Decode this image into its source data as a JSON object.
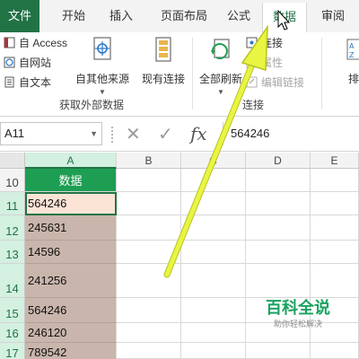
{
  "ribbon_tabs": {
    "file": "文件",
    "home": "开始",
    "insert": "插入",
    "page_layout": "页面布局",
    "formulas": "公式",
    "data": "数据",
    "review": "审阅"
  },
  "ribbon": {
    "from_access": "自 Access",
    "from_web": "自网站",
    "from_text": "自文本",
    "from_other_sources": "自其他来源",
    "existing_connections": "现有连接",
    "refresh_all": "全部刷新",
    "connections": "连接",
    "properties": "属性",
    "edit_links": "编辑链接",
    "group_external_data": "获取外部数据",
    "group_connections": "连接",
    "sort_partial": "排"
  },
  "formula_bar": {
    "name_box": "A11",
    "fx": "fx",
    "value": "564246"
  },
  "columns": [
    "A",
    "B",
    "C",
    "D",
    "E"
  ],
  "rows": [
    {
      "num": "10",
      "value": "数据"
    },
    {
      "num": "11",
      "value": "564246"
    },
    {
      "num": "12",
      "value": "245631"
    },
    {
      "num": "13",
      "value": "14596"
    },
    {
      "num": "14",
      "value": "241256"
    },
    {
      "num": "15",
      "value": "564246"
    },
    {
      "num": "16",
      "value": "246120"
    },
    {
      "num": "17",
      "value": "789542"
    }
  ],
  "watermark": {
    "title": "百科全说",
    "subtitle": "助你轻松解决"
  },
  "colors": {
    "excel_green": "#217346",
    "header_cell": "#1e9e52",
    "data_fill": "#c9b5ab",
    "arrow": "#e8f542"
  }
}
